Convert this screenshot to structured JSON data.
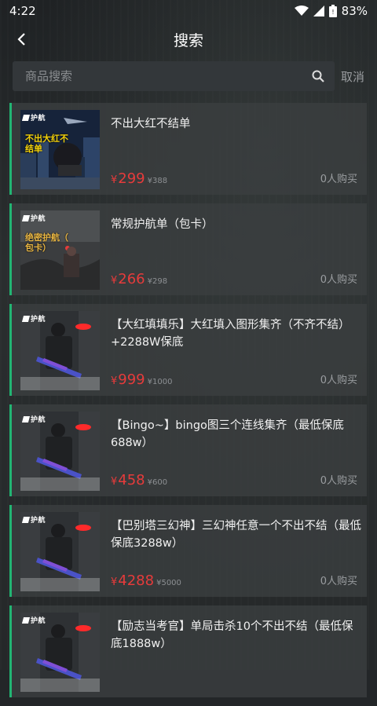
{
  "status": {
    "time": "4:22",
    "battery": "83%"
  },
  "header": {
    "title": "搜索"
  },
  "search": {
    "placeholder": "商品搜索",
    "value": "",
    "cancel_label": "取消"
  },
  "badge_text": "护航",
  "products": [
    {
      "title": "不出大红不结单",
      "price": "299",
      "orig": "388",
      "sold": "0人购买",
      "thumb_text": "不出大红不\n结单",
      "thumb_color": "#f4d20a",
      "scene": "city"
    },
    {
      "title": "常规护航单（包卡）",
      "price": "266",
      "orig": "298",
      "sold": "0人购买",
      "thumb_text": "绝密护航（\n包卡）",
      "thumb_color": "#e9b642",
      "scene": "ruins"
    },
    {
      "title": "【大红填填乐】大红填入图形集齐（不齐不结）+2288W保底",
      "price": "999",
      "orig": "1000",
      "sold": "0人购买",
      "thumb_text": "",
      "thumb_color": "",
      "scene": "soldier"
    },
    {
      "title": "【Bingo~】bingo图三个连线集齐（最低保底688w）",
      "price": "458",
      "orig": "600",
      "sold": "0人购买",
      "thumb_text": "",
      "thumb_color": "",
      "scene": "soldier"
    },
    {
      "title": "【巴别塔三幻神】三幻神任意一个不出不结（最低保底3288w）",
      "price": "4288",
      "orig": "5000",
      "sold": "0人购买",
      "thumb_text": "",
      "thumb_color": "",
      "scene": "soldier"
    },
    {
      "title": "【励志当考官】单局击杀10个不出不结（最低保底1888w）",
      "price": "",
      "orig": "",
      "sold": "",
      "thumb_text": "",
      "thumb_color": "",
      "scene": "soldier"
    }
  ],
  "colors": {
    "accent": "#22b573",
    "price": "#e63b3b"
  }
}
